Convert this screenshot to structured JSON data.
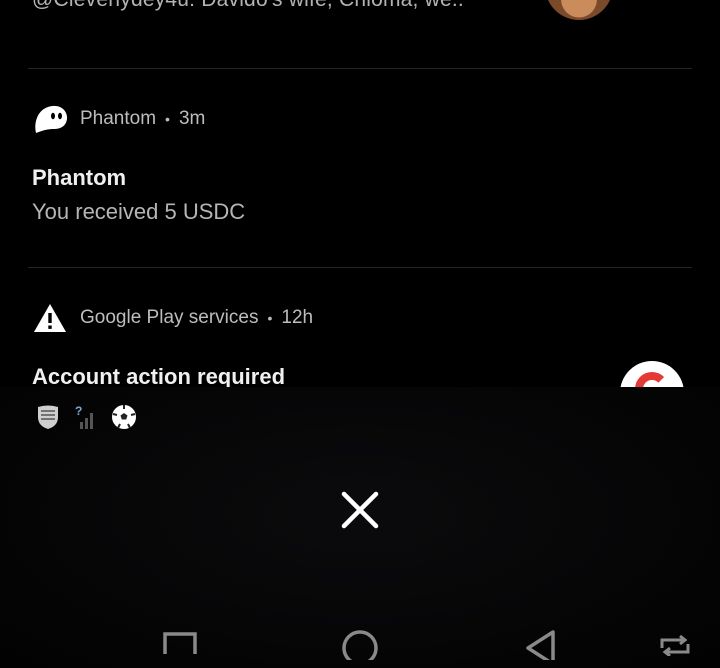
{
  "prev_notification": {
    "text": "@Cleverlydey4u: Davido's wife, Chioma, we.."
  },
  "phantom_notification": {
    "app_name": "Phantom",
    "time": "3m",
    "title": "Phantom",
    "body": "You received 5 USDC",
    "icon": "phantom-ghost-icon"
  },
  "google_notification": {
    "app_name": "Google Play services",
    "time": "12h",
    "title": "Account action required",
    "icon": "warning-icon"
  },
  "status_bar_icons": [
    "porsche-shield-icon",
    "no-signal-icon",
    "soccer-ball-icon"
  ],
  "nav": {
    "recents": "recents-square-icon",
    "home": "home-circle-icon",
    "back": "back-triangle-icon",
    "rotate": "rotate-icon"
  },
  "colors": {
    "background": "#000000",
    "text_primary": "#f0f0f0",
    "text_secondary": "#b5b5b5",
    "accent_red": "#e53935"
  }
}
